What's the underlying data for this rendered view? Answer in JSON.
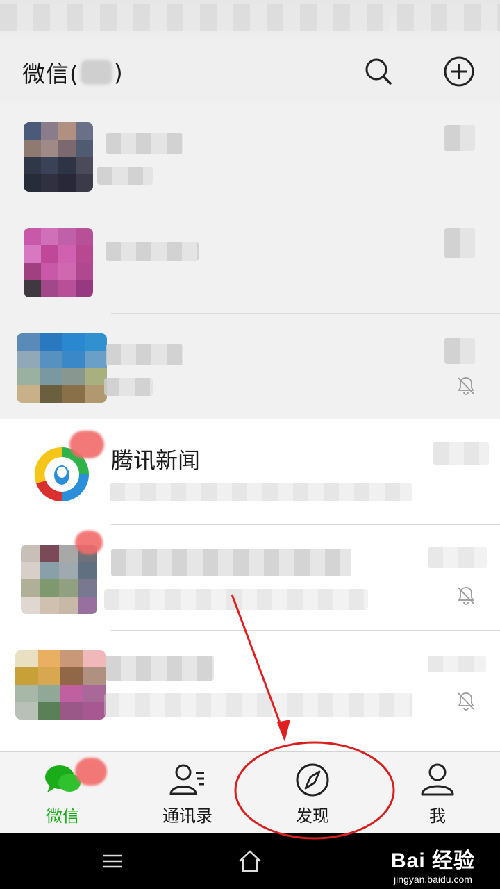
{
  "header": {
    "title_prefix": "微信(",
    "title_suffix": ")",
    "search_icon": "search-icon",
    "add_icon": "plus-circle-icon"
  },
  "chats": [
    {
      "name": "",
      "muted": false
    },
    {
      "name": "",
      "muted": false
    },
    {
      "name": "",
      "muted": true
    },
    {
      "name": "腾讯新闻",
      "muted": false,
      "unread": true
    },
    {
      "name": "",
      "muted": true
    },
    {
      "name": "",
      "muted": true
    }
  ],
  "tabs": [
    {
      "label": "微信",
      "icon": "chat-bubbles-icon",
      "active": true
    },
    {
      "label": "通讯录",
      "icon": "contacts-icon",
      "active": false
    },
    {
      "label": "发现",
      "icon": "compass-icon",
      "active": false
    },
    {
      "label": "我",
      "icon": "person-icon",
      "active": false
    }
  ],
  "watermark": {
    "brand": "Bai 经验",
    "url": "jingyan.baidu.com"
  },
  "colors": {
    "accent_green": "#1aad19",
    "badge_red": "#f26b6b",
    "annotation_red": "#e02020"
  }
}
